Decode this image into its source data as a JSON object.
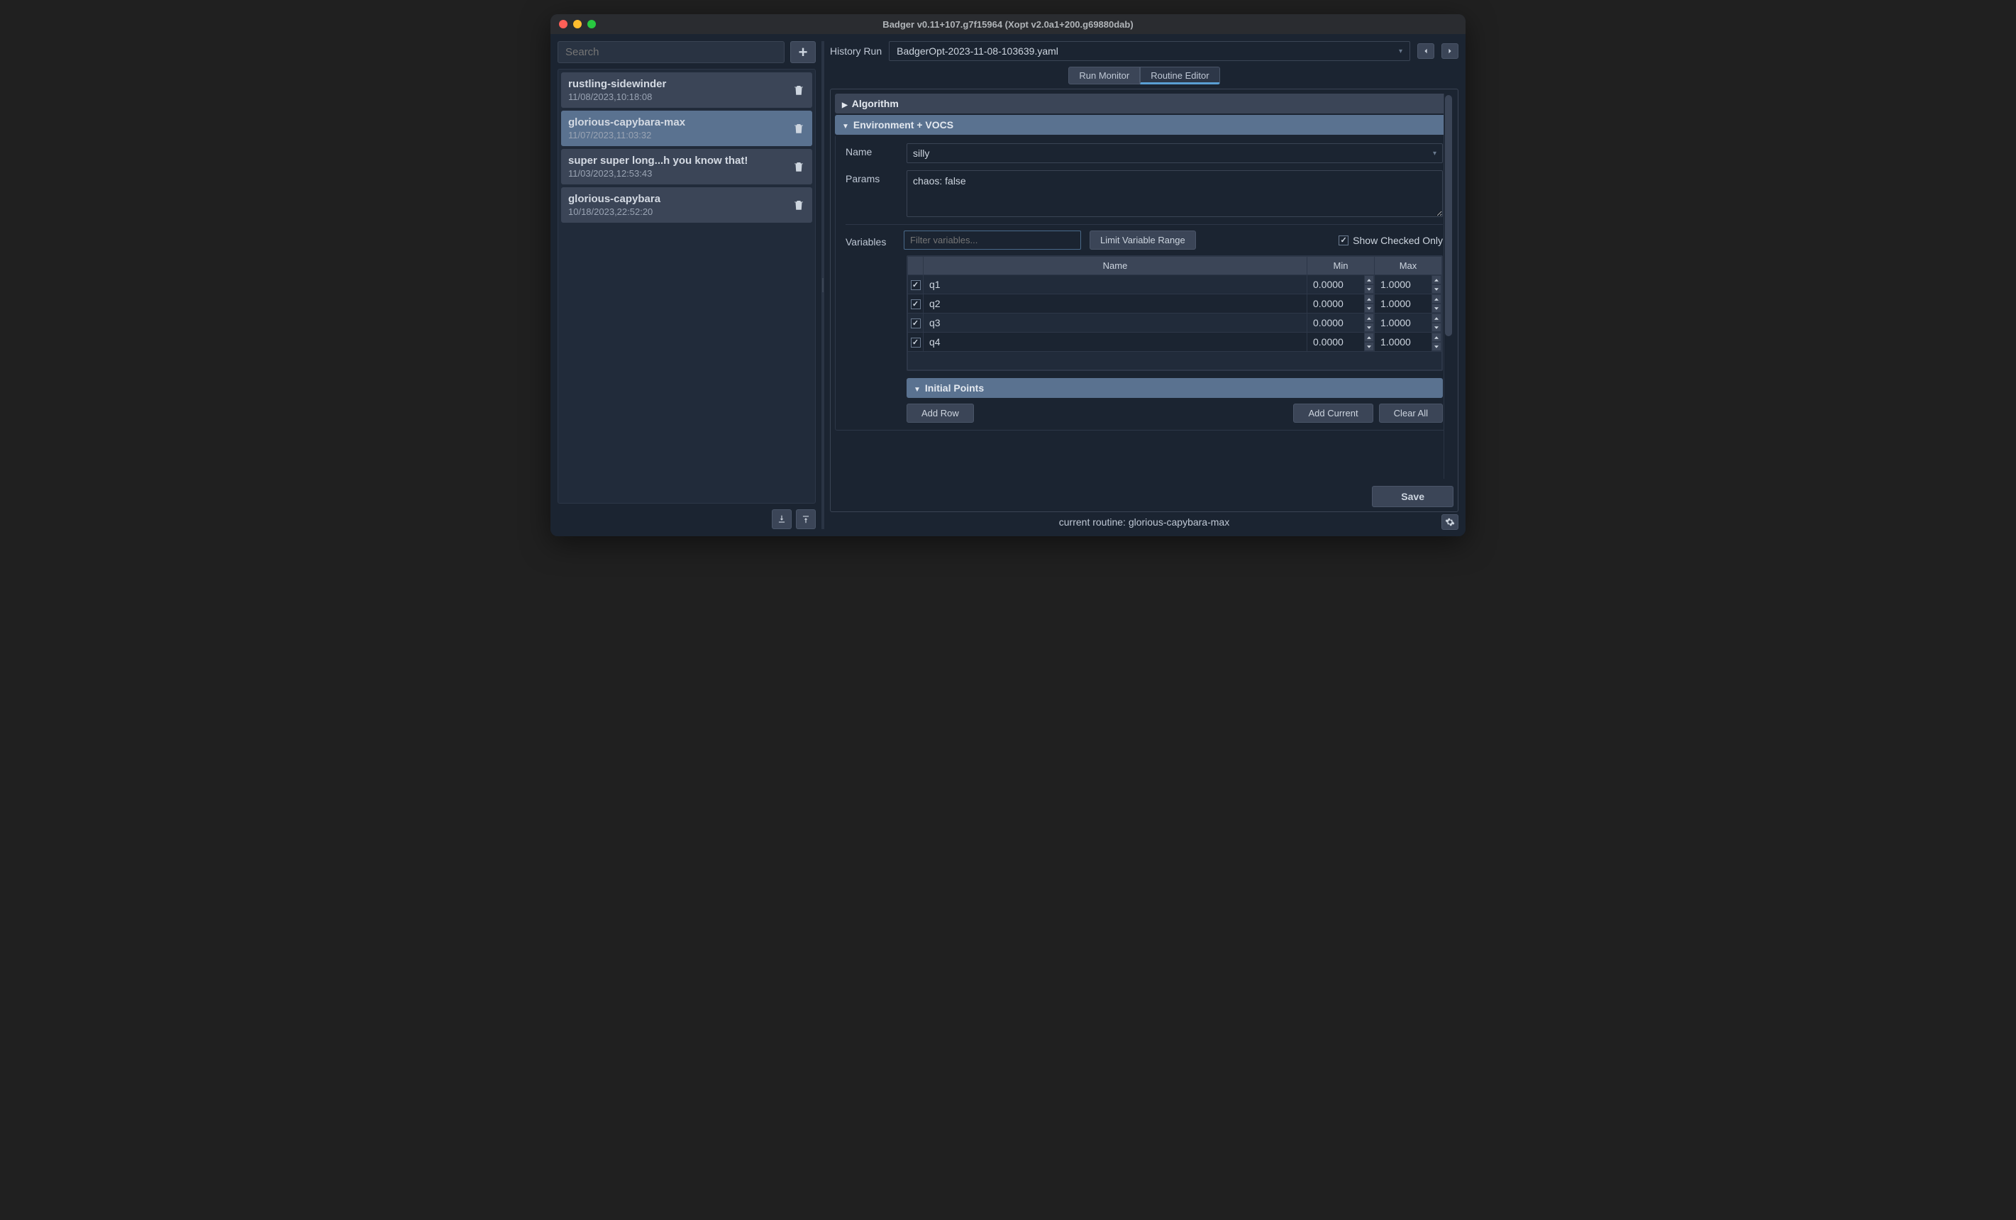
{
  "window": {
    "title": "Badger v0.11+107.g7f15964 (Xopt v2.0a1+200.g69880dab)"
  },
  "sidebar": {
    "search_placeholder": "Search",
    "routines": [
      {
        "name": "rustling-sidewinder",
        "date": "11/08/2023,10:18:08",
        "selected": false
      },
      {
        "name": "glorious-capybara-max",
        "date": "11/07/2023,11:03:32",
        "selected": true
      },
      {
        "name": "super super long...h you know that!",
        "date": "11/03/2023,12:53:43",
        "selected": false
      },
      {
        "name": "glorious-capybara",
        "date": "10/18/2023,22:52:20",
        "selected": false
      }
    ]
  },
  "history": {
    "label": "History Run",
    "selected": "BadgerOpt-2023-11-08-103639.yaml"
  },
  "tabs": {
    "run_monitor": "Run Monitor",
    "routine_editor": "Routine Editor"
  },
  "sections": {
    "algorithm": "Algorithm",
    "env_vocs": "Environment + VOCS",
    "initial_points": "Initial Points"
  },
  "form": {
    "name_label": "Name",
    "name_value": "silly",
    "params_label": "Params",
    "params_value": "chaos: false",
    "variables_label": "Variables",
    "filter_placeholder": "Filter variables...",
    "limit_range": "Limit Variable Range",
    "show_checked": "Show Checked Only"
  },
  "var_table": {
    "headers": {
      "name": "Name",
      "min": "Min",
      "max": "Max"
    },
    "rows": [
      {
        "checked": true,
        "name": "q1",
        "min": "0.0000",
        "max": "1.0000"
      },
      {
        "checked": true,
        "name": "q2",
        "min": "0.0000",
        "max": "1.0000"
      },
      {
        "checked": true,
        "name": "q3",
        "min": "0.0000",
        "max": "1.0000"
      },
      {
        "checked": true,
        "name": "q4",
        "min": "0.0000",
        "max": "1.0000"
      }
    ]
  },
  "buttons": {
    "add_row": "Add Row",
    "add_current": "Add Current",
    "clear_all": "Clear All",
    "save": "Save"
  },
  "status": {
    "text": "current routine: glorious-capybara-max"
  }
}
